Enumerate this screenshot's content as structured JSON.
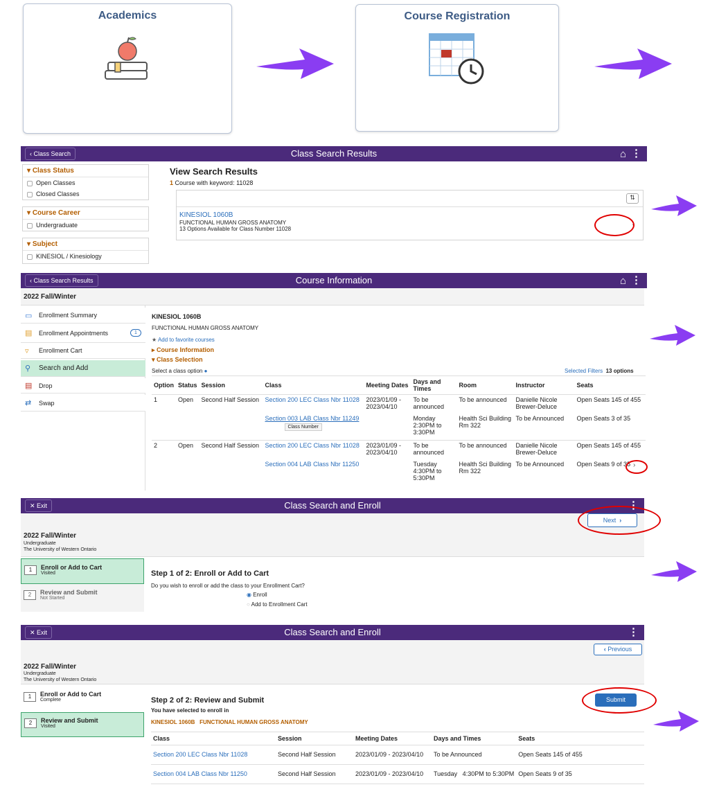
{
  "tiles": {
    "academics": "Academics",
    "registration": "Course Registration"
  },
  "search": {
    "back": "Class Search",
    "title": "Class Search Results",
    "filters": [
      {
        "heading": "Class Status",
        "items": [
          "Open Classes",
          "Closed Classes"
        ]
      },
      {
        "heading": "Course Career",
        "items": [
          "Undergraduate"
        ]
      },
      {
        "heading": "Subject",
        "items": [
          "KINESIOL / Kinesiology"
        ]
      }
    ],
    "heading": "View Search Results",
    "count": "1",
    "count_text": "Course with keyword: 11028",
    "course": "KINESIOL 1060B",
    "course_name": "FUNCTIONAL HUMAN GROSS ANATOMY",
    "options": "13 Options Available for Class Number 11028"
  },
  "info": {
    "back": "Class Search Results",
    "title": "Course Information",
    "term": "2022 Fall/Winter",
    "side": [
      "Enrollment Summary",
      "Enrollment Appointments",
      "Enrollment Cart",
      "Search and Add",
      "Drop",
      "Swap"
    ],
    "appt_badge": "1",
    "course": "KINESIOL 1060B",
    "course_name": "FUNCTIONAL HUMAN GROSS ANATOMY",
    "fav": "Add to favorite courses",
    "ci": "Course Information",
    "cs": "Class Selection",
    "select": "Select a class option",
    "filters": "Selected Filters",
    "opts": "13 options",
    "headers": [
      "Option",
      "Status",
      "Session",
      "Class",
      "Meeting Dates",
      "Days and Times",
      "Room",
      "Instructor",
      "Seats"
    ],
    "rows": [
      {
        "opt": "1",
        "status": "Open",
        "session": "Second Half Session",
        "cls": "Section 200 LEC Class Nbr 11028",
        "dates": "2023/01/09 - 2023/04/10",
        "times": "To be announced",
        "room": "To be announced",
        "instr": "Danielle Nicole Brewer-Deluce",
        "seats": "Open Seats 145 of 455"
      },
      {
        "opt": "",
        "status": "",
        "session": "",
        "cls": "Section 003 LAB Class Nbr 11249",
        "dates": "",
        "times": "Monday 2:30PM to 3:30PM",
        "room": "Health Sci Building Rm 322",
        "instr": "To be Announced",
        "seats": "Open Seats 3 of 35"
      },
      {
        "opt": "2",
        "status": "Open",
        "session": "Second Half Session",
        "cls": "Section 200 LEC Class Nbr 11028",
        "dates": "2023/01/09 - 2023/04/10",
        "times": "To be announced",
        "room": "To be announced",
        "instr": "Danielle Nicole Brewer-Deluce",
        "seats": "Open Seats 145 of 455"
      },
      {
        "opt": "",
        "status": "",
        "session": "",
        "cls": "Section 004 LAB Class Nbr 11250",
        "dates": "",
        "times": "Tuesday 4:30PM to 5:30PM",
        "room": "Health Sci Building Rm 322",
        "instr": "To be Announced",
        "seats": "Open Seats 9 of 35"
      }
    ],
    "tooltip": "Class Number"
  },
  "enroll1": {
    "exit": "Exit",
    "title": "Class Search and Enroll",
    "next": "Next",
    "term": "2022 Fall/Winter",
    "career": "Undergraduate",
    "school": "The University of Western Ontario",
    "s1": "Enroll or Add to Cart",
    "s1_status": "Visited",
    "s2": "Review and Submit",
    "s2_status": "Not Started",
    "heading": "Step 1 of 2: Enroll or Add to Cart",
    "question": "Do you wish to enroll or add the class to your Enrollment Cart?",
    "opt1": "Enroll",
    "opt2": "Add to Enrollment Cart"
  },
  "enroll2": {
    "exit": "Exit",
    "title": "Class Search and Enroll",
    "prev": "Previous",
    "term": "2022 Fall/Winter",
    "career": "Undergraduate",
    "school": "The University of Western Ontario",
    "s1": "Enroll or Add to Cart",
    "s1_status": "Complete",
    "s2": "Review and Submit",
    "s2_status": "Visited",
    "heading": "Step 2 of 2: Review and Submit",
    "selected": "You have selected to enroll in",
    "course": "KINESIOL 1060B   FUNCTIONAL HUMAN GROSS ANATOMY",
    "submit": "Submit",
    "headers": [
      "Class",
      "Session",
      "Meeting Dates",
      "Days and Times",
      "Seats"
    ],
    "rows": [
      {
        "cls": "Section 200 LEC Class Nbr 11028",
        "session": "Second Half Session",
        "dates": "2023/01/09 - 2023/04/10",
        "times": "To be Announced",
        "seats": "Open Seats 145 of 455"
      },
      {
        "cls": "Section 004 LAB Class Nbr 11250",
        "session": "Second Half Session",
        "dates": "2023/01/09 - 2023/04/10",
        "times": "Tuesday   4:30PM to 5:30PM",
        "seats": "Open Seats 9 of 35"
      }
    ]
  }
}
